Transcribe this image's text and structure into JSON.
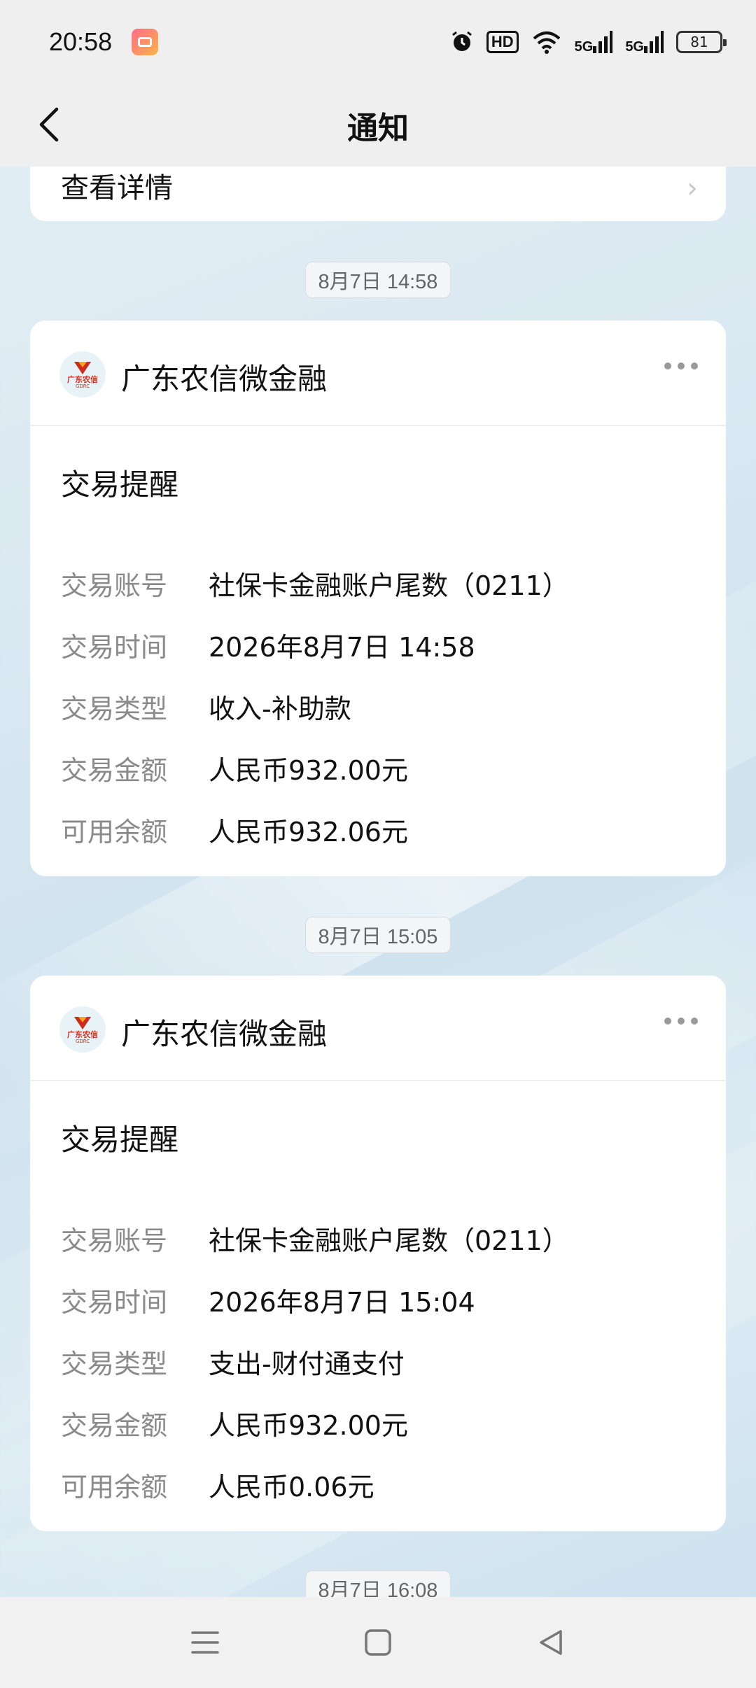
{
  "status_bar": {
    "time": "20:58",
    "hd_label": "HD",
    "signal1_label": "5G",
    "signal2_label": "5G",
    "battery": "81"
  },
  "nav": {
    "title": "通知",
    "back_icon": "chevron-left-icon"
  },
  "partial_card": {
    "link_label": "查看详情"
  },
  "messages": [
    {
      "timestamp": "8月7日 14:58",
      "sender": "广东农信微金融",
      "logo_text": "广东农信",
      "logo_sub": "GDRC",
      "title": "交易提醒",
      "rows": [
        {
          "label": "交易账号",
          "value": "社保卡金融账户尾数（0211）"
        },
        {
          "label": "交易时间",
          "value": "2026年8月7日 14:58"
        },
        {
          "label": "交易类型",
          "value": "收入-补助款"
        },
        {
          "label": "交易金额",
          "value": "人民币932.00元"
        },
        {
          "label": "可用余额",
          "value": "人民币932.06元"
        }
      ]
    },
    {
      "timestamp": "8月7日 15:05",
      "sender": "广东农信微金融",
      "logo_text": "广东农信",
      "logo_sub": "GDRC",
      "title": "交易提醒",
      "rows": [
        {
          "label": "交易账号",
          "value": "社保卡金融账户尾数（0211）"
        },
        {
          "label": "交易时间",
          "value": "2026年8月7日 15:04"
        },
        {
          "label": "交易类型",
          "value": "支出-财付通支付"
        },
        {
          "label": "交易金额",
          "value": "人民币932.00元"
        },
        {
          "label": "可用余额",
          "value": "人民币0.06元"
        }
      ]
    }
  ],
  "next_timestamp": "8月7日 16:08",
  "colors": {
    "card_bg": "#ffffff",
    "label_gray": "#8a8a8a",
    "brand_red": "#d02a1e"
  }
}
